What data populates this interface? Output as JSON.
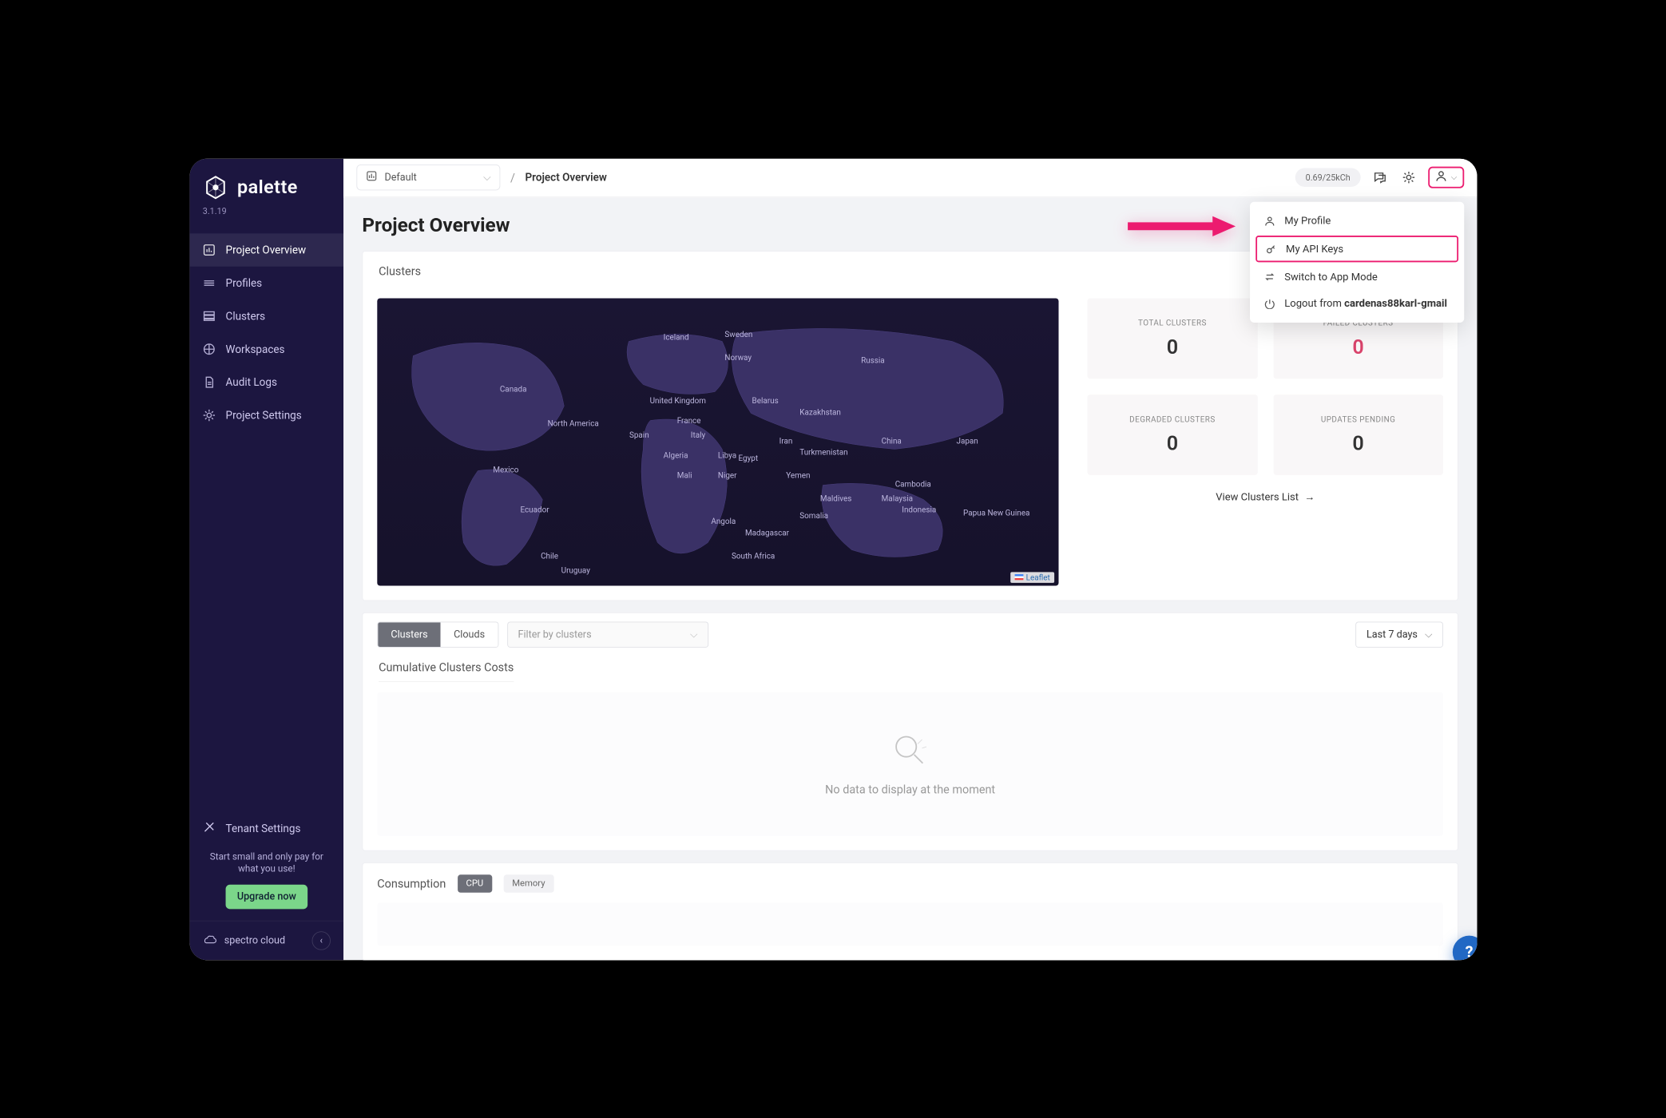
{
  "brand": {
    "name": "palette",
    "version": "3.1.19",
    "collapseLabel": "spectro cloud"
  },
  "sidebar": {
    "items": [
      {
        "label": "Project Overview"
      },
      {
        "label": "Profiles"
      },
      {
        "label": "Clusters"
      },
      {
        "label": "Workspaces"
      },
      {
        "label": "Audit Logs"
      },
      {
        "label": "Project Settings"
      }
    ],
    "tenant": "Tenant Settings",
    "promo": "Start small and only pay for what you use!",
    "upgrade": "Upgrade now"
  },
  "topbar": {
    "projectSelector": "Default",
    "breadcrumb": "Project Overview",
    "usage": "0.69/25kCh"
  },
  "userMenu": {
    "items": [
      {
        "label": "My Profile"
      },
      {
        "label": "My API Keys"
      },
      {
        "label": "Switch to App Mode"
      }
    ],
    "logoutPrefix": "Logout from ",
    "logoutUser": "cardenas88karl-gmail"
  },
  "page": {
    "title": "Project Overview"
  },
  "clusters": {
    "title": "Clusters",
    "leaflet": "Leaflet",
    "stats": [
      {
        "label": "Total Clusters",
        "value": "0"
      },
      {
        "label": "Failed Clusters",
        "value": "0"
      },
      {
        "label": "Degraded Clusters",
        "value": "0"
      },
      {
        "label": "Updates Pending",
        "value": "0"
      }
    ],
    "viewListLabel": "View Clusters List",
    "mapLabels": [
      "Iceland",
      "Sweden",
      "Norway",
      "Russia",
      "Canada",
      "United Kingdom",
      "Belarus",
      "Kazakhstan",
      "North America",
      "France",
      "Spain",
      "Italy",
      "Algeria",
      "Libya",
      "Iran",
      "China",
      "Japan",
      "Mexico",
      "Mali",
      "Niger",
      "Turkmenistan",
      "Yemen",
      "Cambodia",
      "Maldives",
      "Malaysia",
      "Indonesia",
      "Papua New Guinea",
      "Ecuador",
      "Angola",
      "Somalia",
      "Madagascar",
      "Chile",
      "South Africa",
      "Uruguay",
      "Egypt"
    ]
  },
  "filters": {
    "seg1": "Clusters",
    "seg2": "Clouds",
    "filterPlaceholder": "Filter by clusters",
    "range": "Last 7 days"
  },
  "costs": {
    "title": "Cumulative Clusters Costs",
    "empty": "No data to display at the moment"
  },
  "consumption": {
    "title": "Consumption",
    "cpu": "CPU",
    "memory": "Memory"
  },
  "help": "?"
}
